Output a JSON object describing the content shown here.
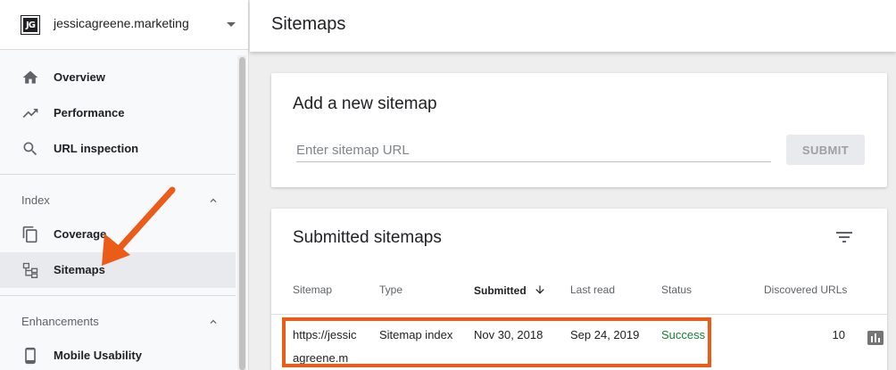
{
  "property": {
    "logo": "JG",
    "name": "jessicagreene.marketing"
  },
  "sidebar": {
    "items": [
      {
        "label": "Overview",
        "icon": "home-icon"
      },
      {
        "label": "Performance",
        "icon": "trending-up-icon"
      },
      {
        "label": "URL inspection",
        "icon": "search-icon"
      }
    ],
    "index": {
      "heading": "Index",
      "items": [
        {
          "label": "Coverage",
          "icon": "copy-icon"
        },
        {
          "label": "Sitemaps",
          "icon": "sitemap-icon",
          "active": true
        }
      ]
    },
    "enhancements": {
      "heading": "Enhancements",
      "items": [
        {
          "label": "Mobile Usability",
          "icon": "phone-icon"
        }
      ]
    }
  },
  "header": {
    "title": "Sitemaps"
  },
  "add_sitemap": {
    "title": "Add a new sitemap",
    "placeholder": "Enter sitemap URL",
    "submit_label": "SUBMIT"
  },
  "submitted": {
    "title": "Submitted sitemaps",
    "columns": [
      "Sitemap",
      "Type",
      "Submitted",
      "Last read",
      "Status",
      "Discovered URLs"
    ],
    "rows": [
      {
        "sitemap": "https://jessicagreene.m",
        "type": "Sitemap index",
        "submitted": "Nov 30, 2018",
        "last_read": "Sep 24, 2019",
        "status": "Success",
        "discovered_urls": "10"
      }
    ]
  },
  "colors": {
    "accent_orange": "#ea5c17",
    "success_green": "#188038"
  }
}
